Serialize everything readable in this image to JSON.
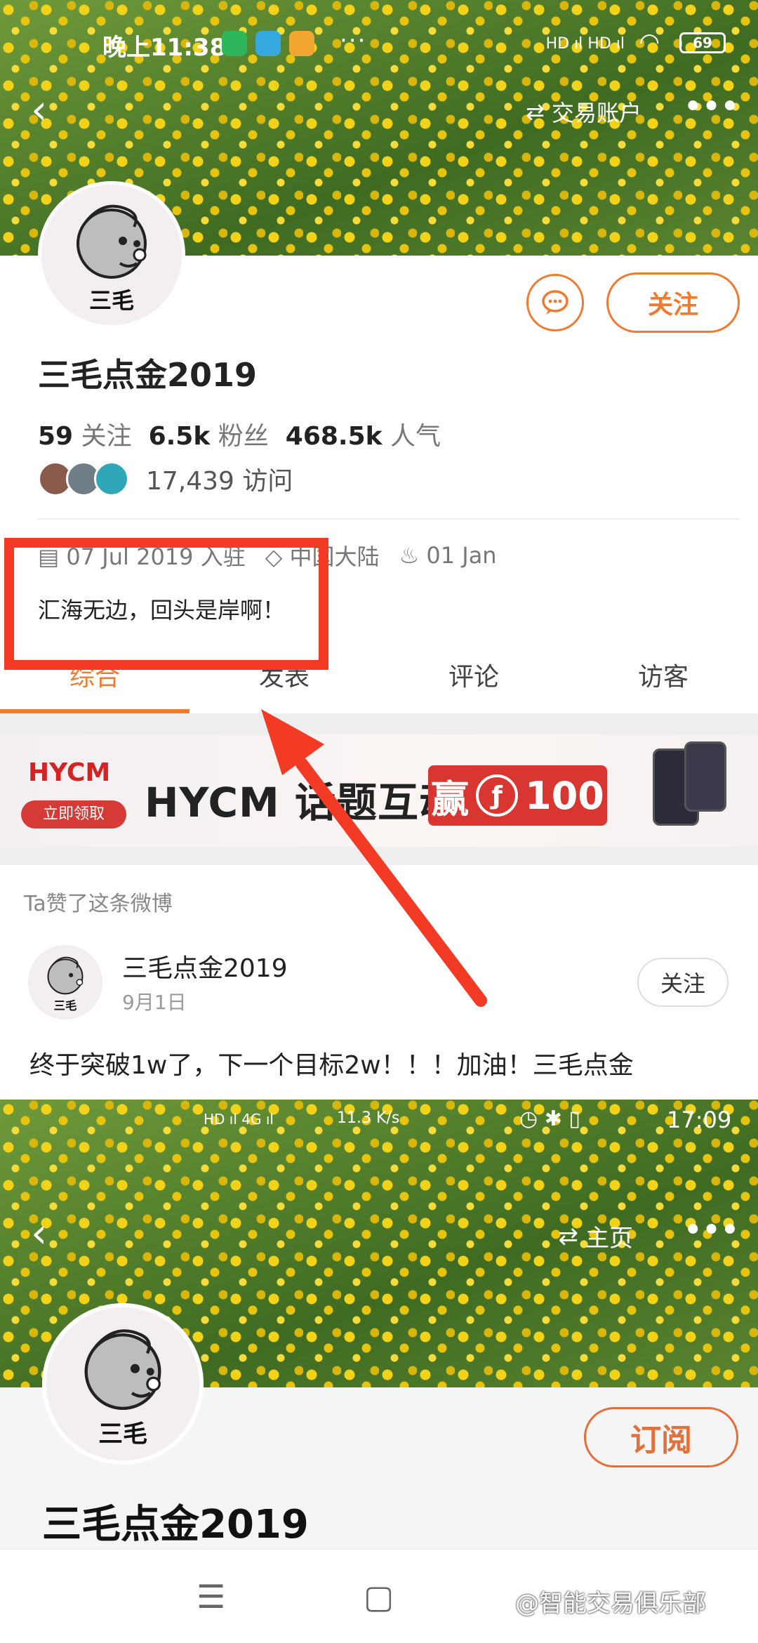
{
  "status_bar_1": {
    "time": "晚上11:38",
    "signal": "HD ıl HD ıl",
    "battery": "69",
    "dots": "···"
  },
  "nav_1": {
    "account_label": "交易账户",
    "swap_icon": "⇄"
  },
  "profile": {
    "name": "三毛点金2019",
    "follow_label": "关注",
    "avatar_text": "三毛",
    "stats": [
      {
        "value": "59",
        "label": "关注"
      },
      {
        "value": "6.5k",
        "label": "粉丝"
      },
      {
        "value": "468.5k",
        "label": "人气"
      }
    ],
    "visits": "17,439 访问",
    "joined": "07 Jul 2019 入驻",
    "location": "中国大陆",
    "birthday": "01 Jan",
    "bio": "汇海无边，回头是岸啊！"
  },
  "tabs": [
    "综合",
    "发表",
    "评论",
    "访客"
  ],
  "ad": {
    "brand": "HYCM",
    "cta": "立即领取",
    "headline": "HYCM 话题互动",
    "prize_prefix": "赢",
    "prize_amount": "100"
  },
  "feed": {
    "liked_note": "Ta赞了这条微博",
    "author": "三毛点金2019",
    "date": "9月1日",
    "follow_label": "关注",
    "text": "终于突破1w了，下一个目标2w！！！加油！三毛点金"
  },
  "status_bar_2": {
    "speed": "11.3 K/s",
    "time": "17:09"
  },
  "nav_2": {
    "home_label": "主页",
    "swap_icon": "⇄"
  },
  "profile_2": {
    "name": "三毛点金2019",
    "subscribe_label": "订阅"
  },
  "bottom_nav": {
    "menu_icon": "☰",
    "home_icon": "▢"
  },
  "watermark": "@智能交易俱乐部",
  "colors": {
    "accent": "#f07b30",
    "highlight": "#f23a24"
  }
}
